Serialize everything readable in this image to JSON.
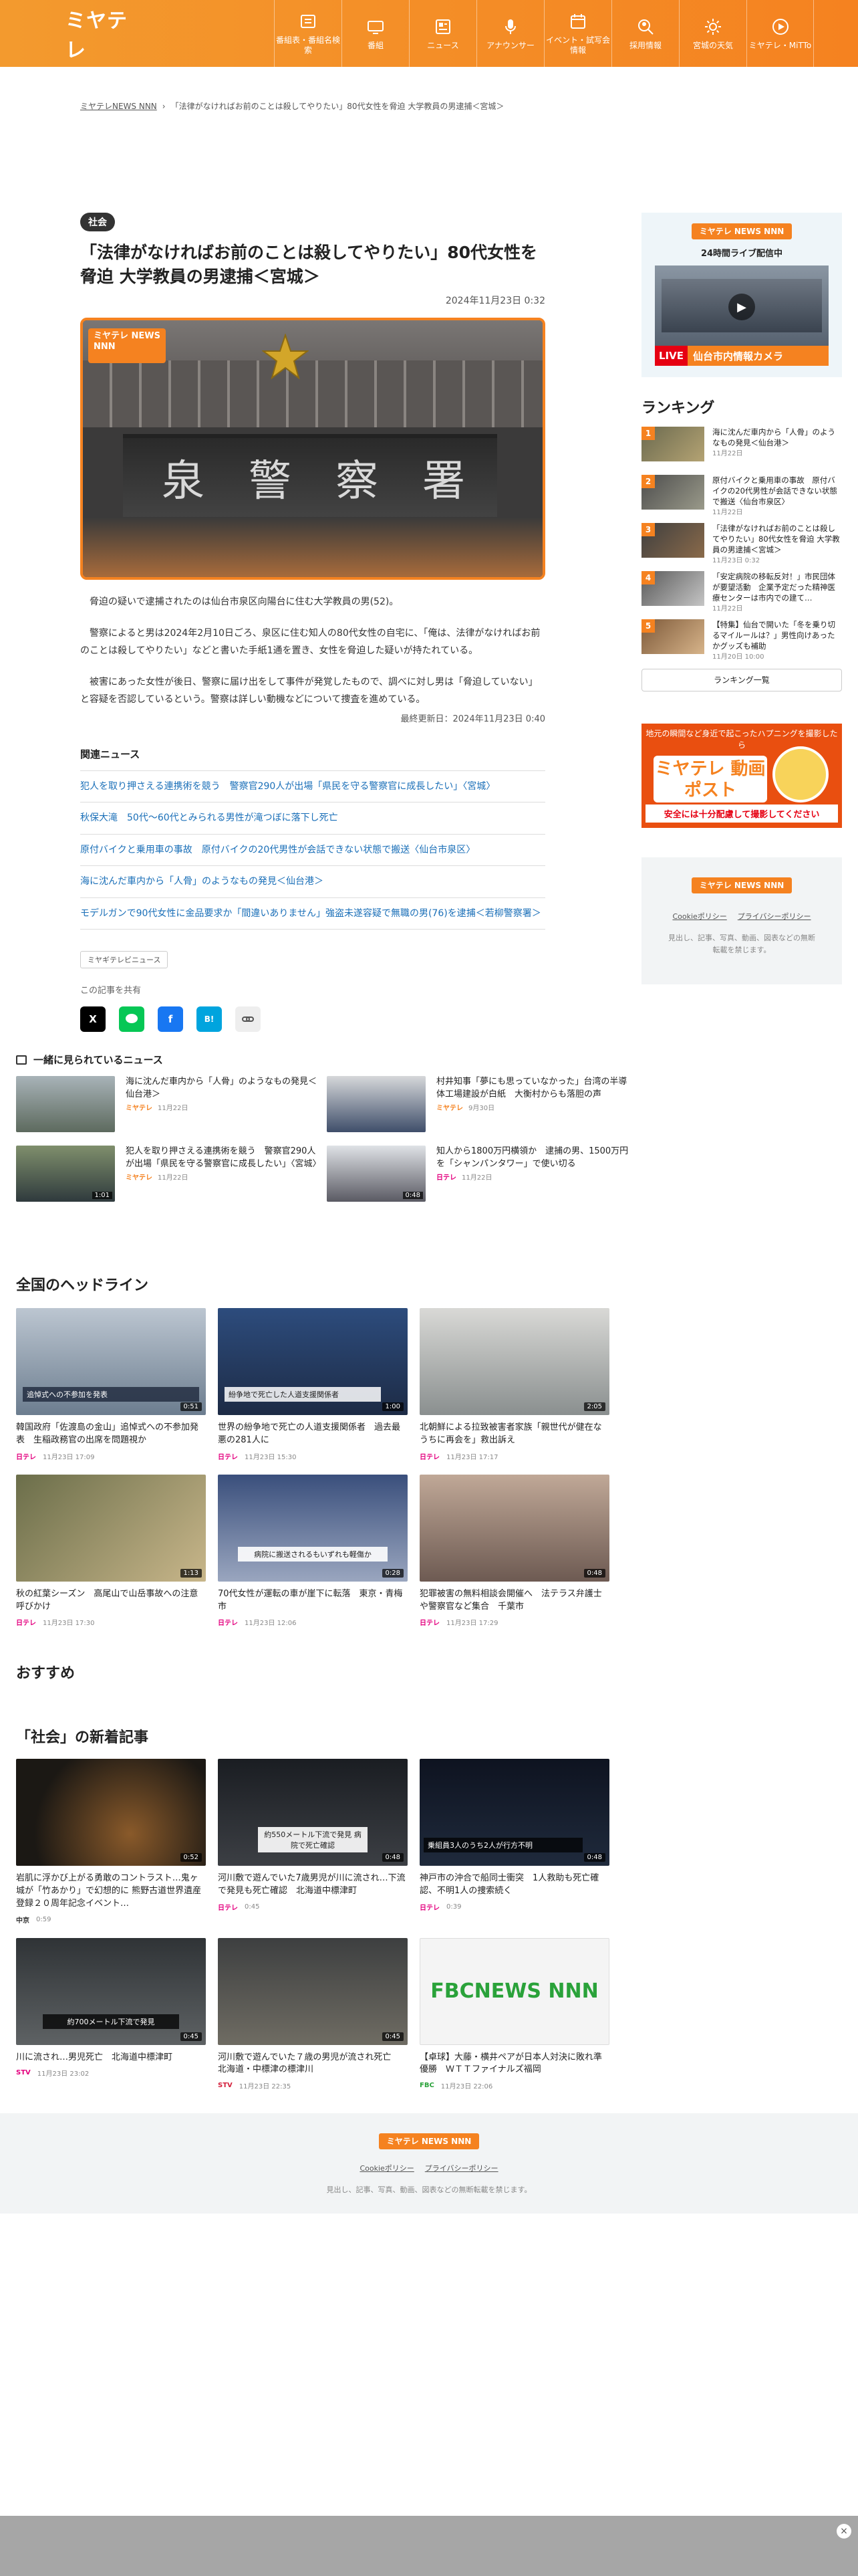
{
  "header": {
    "logo": "ミヤテレ",
    "nav": [
      {
        "label": "番組表・番組名検索",
        "icon": "tv-guide-icon"
      },
      {
        "label": "番組",
        "icon": "tv-icon"
      },
      {
        "label": "ニュース",
        "icon": "news-icon"
      },
      {
        "label": "アナウンサー",
        "icon": "microphone-icon"
      },
      {
        "label": "イベント・試写会情報",
        "icon": "calendar-icon"
      },
      {
        "label": "採用情報",
        "icon": "search-person-icon"
      },
      {
        "label": "宮城の天気",
        "icon": "sun-icon"
      },
      {
        "label": "ミヤテレ・MiTTo",
        "icon": "play-icon"
      }
    ]
  },
  "breadcrumb": {
    "home": "ミヤテレNEWS NNN",
    "current": "「法律がなければお前のことは殺してやりたい」80代女性を脅迫 大学教員の男逮捕＜宮城＞"
  },
  "article": {
    "category": "社会",
    "title": "「法律がなければお前のことは殺してやりたい」80代女性を脅迫 大学教員の男逮捕＜宮城＞",
    "date": "2024年11月23日 0:32",
    "image_logo": "ミヤテレ NEWS NNN",
    "sign_chars": [
      "泉",
      "警",
      "察",
      "署"
    ],
    "paragraphs": [
      "脅迫の疑いで逮捕されたのは仙台市泉区向陽台に住む大学教員の男(52)。",
      "警察によると男は2024年2月10日ごろ、泉区に住む知人の80代女性の自宅に、「俺は、法律がなければお前のことは殺してやりたい」などと書いた手紙1通を置き、女性を脅迫した疑いが持たれている。",
      "被害にあった女性が後日、警察に届け出をして事件が発覚したもので、調べに対し男は「脅迫していない」と容疑を否認しているという。警察は詳しい動機などについて捜査を進めている。"
    ],
    "updated": "最終更新日：2024年11月23日 0:40",
    "related_heading": "関連ニュース",
    "related": [
      "犯人を取り押さえる連携術を競う　警察官290人が出場「県民を守る警察官に成長したい」〈宮城〉",
      "秋保大滝　50代〜60代とみられる男性が滝つぼに落下し死亡",
      "原付バイクと乗用車の事故　原付バイクの20代男性が会話できない状態で搬送〈仙台市泉区〉",
      "海に沈んだ車内から「人骨」のようなもの発見＜仙台港＞",
      "モデルガンで90代女性に金品要求か「間違いありません」強盗未遂容疑で無職の男(76)を逮捕＜若柳警察署＞"
    ],
    "tag": "ミヤギテレビニュース",
    "share_heading": "この記事を共有"
  },
  "sidebar": {
    "live_logo": "ミヤテレ NEWS NNN",
    "live_text": "24時間ライブ配信中",
    "live_badge": "LIVE",
    "live_caption": "仙台市内情報カメラ",
    "ranking_heading": "ランキング",
    "ranking": [
      {
        "title": "海に沈んだ車内から「人骨」のようなもの発見＜仙台港＞",
        "date": "11月22日"
      },
      {
        "title": "原付バイクと乗用車の事故　原付バイクの20代男性が会話できない状態で搬送〈仙台市泉区〉",
        "date": "11月22日"
      },
      {
        "title": "「法律がなければお前のことは殺してやりたい」80代女性を脅迫 大学教員の男逮捕＜宮城＞",
        "date": "11月23日 0:32"
      },
      {
        "title": "「安定病院の移転反対！」市民団体が要望活動　企業予定だった精神医療センターは市内での建て…",
        "date": "11月22日"
      },
      {
        "title": "【特集】仙台で開いた「冬を乗り切るマイルールは？」男性向けあったかグッズも補助",
        "date": "11月20日 10:00"
      }
    ],
    "ranking_more": "ランキング一覧",
    "post_top": "地元の瞬間など身近で起こったハプニングを撮影したら",
    "post_logo": "ミヤテレ 動画ポスト",
    "post_bottom": "安全には十分配慮して撮影してください",
    "footer_logo": "ミヤテレ NEWS NNN",
    "cookie": "Cookieポリシー",
    "privacy": "プライバシーポリシー",
    "note": "見出し、記事、写真、動画、図表などの無断転載を禁じます。"
  },
  "widely_read": {
    "heading": "一緒に見られているニュース",
    "items": [
      {
        "title": "海に沈んだ車内から「人骨」のようなもの発見＜仙台港＞",
        "src": "ミヤテレ",
        "date": "11月22日",
        "dur": ""
      },
      {
        "title": "村井知事「夢にも思っていなかった」台湾の半導体工場建設が白紙　大衡村からも落胆の声",
        "src": "ミヤテレ",
        "date": "9月30日",
        "dur": ""
      },
      {
        "title": "犯人を取り押さえる連携術を競う　警察官290人が出場「県民を守る警察官に成長したい」〈宮城〉",
        "src": "ミヤテレ",
        "date": "11月22日",
        "dur": "1:01"
      },
      {
        "title": "知人から1800万円横領か　逮捕の男、1500万円を「シャンパンタワー」で使い切る",
        "src": "日テレ",
        "date": "11月22日",
        "dur": "0:48"
      }
    ]
  },
  "national": {
    "heading": "全国のヘッドライン",
    "items": [
      {
        "title": "韓国政府「佐渡島の金山」追悼式への不参加発表　生稲政務官の出席を問題視か",
        "src": "日テレ",
        "date": "11月23日 17:09",
        "dur": "0:51",
        "cap": "追悼式への不参加を発表"
      },
      {
        "title": "世界の紛争地で死亡の人道支援関係者　過去最悪の281人に",
        "src": "日テレ",
        "date": "11月23日 15:30",
        "dur": "1:00",
        "cap": "紛争地で死亡した人道支援関係者"
      },
      {
        "title": "北朝鮮による拉致被害者家族「親世代が健在なうちに再会を」救出訴え",
        "src": "日テレ",
        "date": "11月23日 17:17",
        "dur": "2:05",
        "cap": ""
      },
      {
        "title": "秋の紅葉シーズン　高尾山で山岳事故への注意呼びかけ",
        "src": "日テレ",
        "date": "11月23日 17:30",
        "dur": "1:13",
        "cap": ""
      },
      {
        "title": "70代女性が運転の車が崖下に転落　東京・青梅市",
        "src": "日テレ",
        "date": "11月23日 12:06",
        "dur": "0:28",
        "cap": "病院に搬送されるもいずれも軽傷か"
      },
      {
        "title": "犯罪被害の無料相談会開催へ　法テラス弁護士や警察官など集合　千葉市",
        "src": "日テレ",
        "date": "11月23日 17:29",
        "dur": "0:48",
        "cap": ""
      }
    ]
  },
  "recommend_heading": "おすすめ",
  "social": {
    "heading": "「社会」の新着記事",
    "items": [
      {
        "title": "岩肌に浮かび上がる勇敢のコントラスト…鬼ヶ城が「竹あかり」で幻想的に 熊野古道世界遺産登録２０周年記念イベント…",
        "src": "中京",
        "date": "0:59",
        "dur": "0:52",
        "cap": ""
      },
      {
        "title": "河川敷で遊んでいた7歳男児が川に流され…下流で発見も死亡確認　北海道中標津町",
        "src": "日テレ",
        "date": "0:45",
        "dur": "0:48",
        "cap": "約550メートル下流で発見 病院で死亡確認"
      },
      {
        "title": "神戸市の沖合で船同士衝突　1人救助も死亡確認、不明1人の捜索続く",
        "src": "日テレ",
        "date": "0:39",
        "dur": "0:48",
        "cap": "乗組員3人のうち2人が行方不明"
      },
      {
        "title": "川に流され…男児死亡　北海道中標津町",
        "src": "STV",
        "date": "11月23日 23:02",
        "dur": "0:45",
        "cap": "約700メートル下流で発見"
      },
      {
        "title": "河川敷で遊んでいた７歳の男児が流され死亡　北海道・中標津の標津川",
        "src": "STV",
        "date": "11月23日 22:35",
        "dur": "0:45",
        "cap": ""
      },
      {
        "title": "【卓球】大藤・横井ペアが日本人対決に敗れ準優勝　ＷＴＴファイナルズ福岡",
        "src": "FBC",
        "date": "11月23日 22:06",
        "dur": "",
        "cap": "FBCNEWS NNN"
      }
    ]
  },
  "footer": {
    "logo": "ミヤテレ NEWS NNN",
    "cookie": "Cookieポリシー",
    "privacy": "プライバシーポリシー",
    "note": "見出し、記事、写真、動画、図表などの無断転載を禁じます。"
  },
  "colors": {
    "brand": "#f58220",
    "link": "#1a6fb8"
  }
}
